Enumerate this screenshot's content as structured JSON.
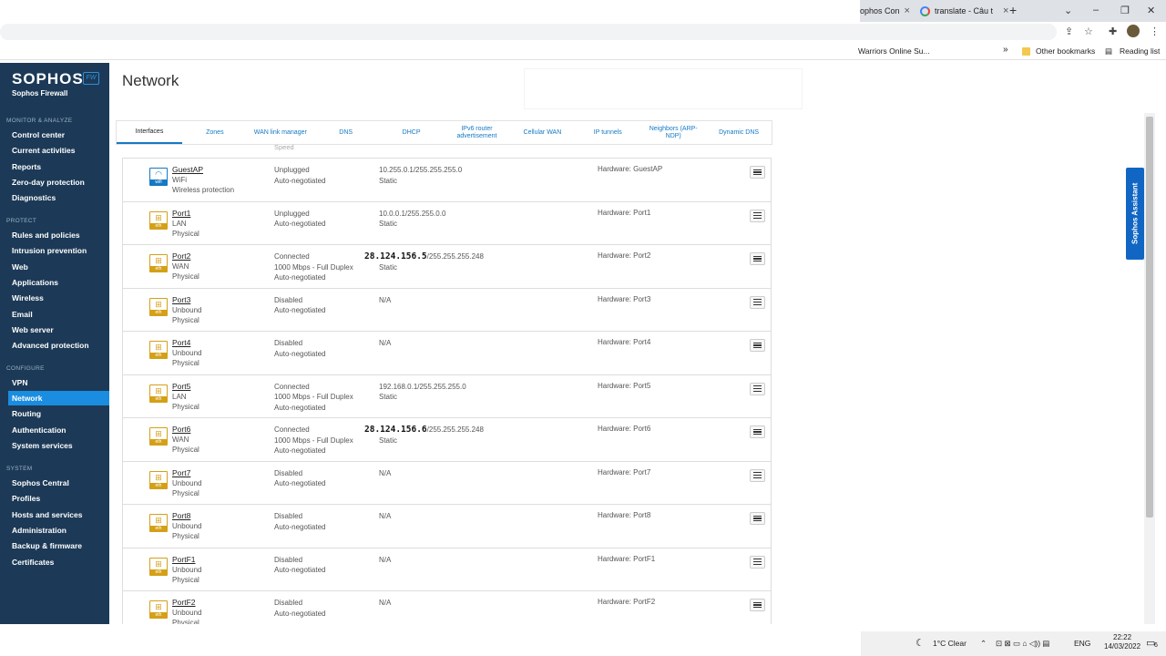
{
  "browser": {
    "tabs": [
      {
        "label": "ophos Con",
        "close": "×"
      },
      {
        "label": "translate - Câu t",
        "close": "×"
      }
    ],
    "new_tab": "+",
    "bookmarks": {
      "partial": "Warriors Online Su...",
      "more": "»",
      "other": "Other bookmarks",
      "reading": "Reading list"
    }
  },
  "sidebar": {
    "brand": "SOPHOS",
    "brand_sub": "Sophos Firewall",
    "badge": "FW",
    "sections": [
      {
        "title": "MONITOR & ANALYZE",
        "items": [
          "Control center",
          "Current activities",
          "Reports",
          "Zero-day protection",
          "Diagnostics"
        ]
      },
      {
        "title": "PROTECT",
        "items": [
          "Rules and policies",
          "Intrusion prevention",
          "Web",
          "Applications",
          "Wireless",
          "Email",
          "Web server",
          "Advanced protection"
        ]
      },
      {
        "title": "CONFIGURE",
        "items": [
          "VPN",
          "Network",
          "Routing",
          "Authentication",
          "System services"
        ]
      },
      {
        "title": "SYSTEM",
        "items": [
          "Sophos Central",
          "Profiles",
          "Hosts and services",
          "Administration",
          "Backup & firmware",
          "Certificates"
        ]
      }
    ],
    "active_item": "Network"
  },
  "main": {
    "title": "Network",
    "tabs": [
      "Interfaces",
      "Zones",
      "WAN link manager",
      "DNS",
      "DHCP",
      "IPv6 router advertisement",
      "Cellular WAN",
      "IP tunnels",
      "Neighbors (ARP-NDP)",
      "Dynamic DNS"
    ],
    "active_tab": "Interfaces",
    "speed_hint": "Speed",
    "rows": [
      {
        "name": "GuestAP",
        "zone": "WiFi",
        "type": "Wireless protection",
        "status": "Unplugged",
        "speed": "Auto-negotiated",
        "duplex": "",
        "ip_bold": "",
        "ip": "10.255.0.1/255.255.255.0",
        "mode": "Static",
        "hw_label": "Hardware:",
        "hw": "GuestAP",
        "icon": "wifi",
        "icon_band": "wifi"
      },
      {
        "name": "Port1",
        "zone": "LAN",
        "type": "Physical",
        "status": "Unplugged",
        "speed": "Auto-negotiated",
        "duplex": "",
        "ip_bold": "",
        "ip": "10.0.0.1/255.255.0.0",
        "mode": "Static",
        "hw_label": "Hardware:",
        "hw": "Port1",
        "icon": "eth",
        "icon_band": "eth"
      },
      {
        "name": "Port2",
        "zone": "WAN",
        "type": "Physical",
        "status": "Connected",
        "speed": "1000 Mbps - Full Duplex",
        "duplex": "Auto-negotiated",
        "ip_bold": "28.124.156.5",
        "ip": "/255.255.255.248",
        "mode": "Static",
        "hw_label": "Hardware:",
        "hw": "Port2",
        "icon": "eth",
        "icon_band": "eth"
      },
      {
        "name": "Port3",
        "zone": "Unbound",
        "type": "Physical",
        "status": "Disabled",
        "speed": "Auto-negotiated",
        "duplex": "",
        "ip_bold": "",
        "ip": "N/A",
        "mode": "",
        "hw_label": "Hardware:",
        "hw": "Port3",
        "icon": "eth",
        "icon_band": "eth"
      },
      {
        "name": "Port4",
        "zone": "Unbound",
        "type": "Physical",
        "status": "Disabled",
        "speed": "Auto-negotiated",
        "duplex": "",
        "ip_bold": "",
        "ip": "N/A",
        "mode": "",
        "hw_label": "Hardware:",
        "hw": "Port4",
        "icon": "eth",
        "icon_band": "eth"
      },
      {
        "name": "Port5",
        "zone": "LAN",
        "type": "Physical",
        "status": "Connected",
        "speed": "1000 Mbps - Full Duplex",
        "duplex": "Auto-negotiated",
        "ip_bold": "",
        "ip": "192.168.0.1/255.255.255.0",
        "mode": "Static",
        "hw_label": "Hardware:",
        "hw": "Port5",
        "icon": "eth",
        "icon_band": "eth"
      },
      {
        "name": "Port6",
        "zone": "WAN",
        "type": "Physical",
        "status": "Connected",
        "speed": "1000 Mbps - Full Duplex",
        "duplex": "Auto-negotiated",
        "ip_bold": "28.124.156.6",
        "ip": "/255.255.255.248",
        "mode": "Static",
        "hw_label": "Hardware:",
        "hw": "Port6",
        "icon": "eth",
        "icon_band": "eth"
      },
      {
        "name": "Port7",
        "zone": "Unbound",
        "type": "Physical",
        "status": "Disabled",
        "speed": "Auto-negotiated",
        "duplex": "",
        "ip_bold": "",
        "ip": "N/A",
        "mode": "",
        "hw_label": "Hardware:",
        "hw": "Port7",
        "icon": "eth",
        "icon_band": "eth"
      },
      {
        "name": "Port8",
        "zone": "Unbound",
        "type": "Physical",
        "status": "Disabled",
        "speed": "Auto-negotiated",
        "duplex": "",
        "ip_bold": "",
        "ip": "N/A",
        "mode": "",
        "hw_label": "Hardware:",
        "hw": "Port8",
        "icon": "eth",
        "icon_band": "eth"
      },
      {
        "name": "PortF1",
        "zone": "Unbound",
        "type": "Physical",
        "status": "Disabled",
        "speed": "Auto-negotiated",
        "duplex": "",
        "ip_bold": "",
        "ip": "N/A",
        "mode": "",
        "hw_label": "Hardware:",
        "hw": "PortF1",
        "icon": "eth",
        "icon_band": "eth"
      },
      {
        "name": "PortF2",
        "zone": "Unbound",
        "type": "Physical",
        "status": "Disabled",
        "speed": "Auto-negotiated",
        "duplex": "",
        "ip_bold": "",
        "ip": "N/A",
        "mode": "",
        "hw_label": "Hardware:",
        "hw": "PortF2",
        "icon": "eth",
        "icon_band": "eth"
      }
    ]
  },
  "assistant": "Sophos Assistant",
  "taskbar": {
    "weather": "1°C  Clear",
    "lang": "ENG",
    "time": "22:22",
    "date": "14/03/2022",
    "notif_count": "6"
  },
  "colors": {
    "sidebar": "#1c3a57",
    "accent": "#1a8de0",
    "eth_icon": "#d4a017",
    "assistant": "#1166c4"
  }
}
